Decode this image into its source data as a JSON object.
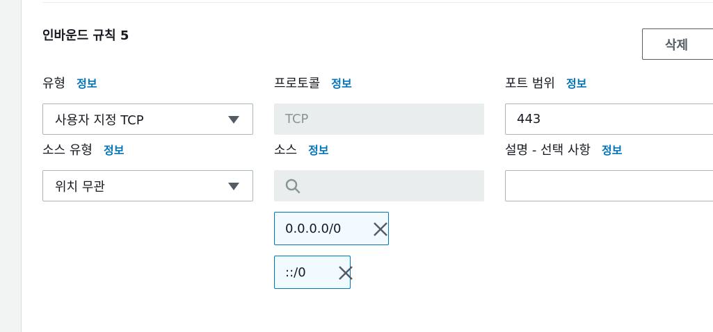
{
  "rule": {
    "title": "인바운드 규칙 5",
    "delete_label": "삭제"
  },
  "info_label": "정보",
  "fields": {
    "type": {
      "label": "유형",
      "value": "사용자 지정 TCP"
    },
    "protocol": {
      "label": "프로토콜",
      "value": "TCP"
    },
    "port_range": {
      "label": "포트 범위",
      "value": "443"
    },
    "source_type": {
      "label": "소스 유형",
      "value": "위치 무관"
    },
    "source": {
      "label": "소스",
      "search_value": "",
      "tokens": [
        "0.0.0.0/0",
        "::/0"
      ]
    },
    "description": {
      "label": "설명 - 선택 사항",
      "value": ""
    }
  },
  "colors": {
    "link": "#0073bb",
    "token_border": "#0073bb",
    "token_bg": "#f1faff",
    "disabled_bg": "#eaeded"
  },
  "icons": {
    "caret": "caret-down-icon",
    "search": "search-icon",
    "remove": "close-icon"
  }
}
